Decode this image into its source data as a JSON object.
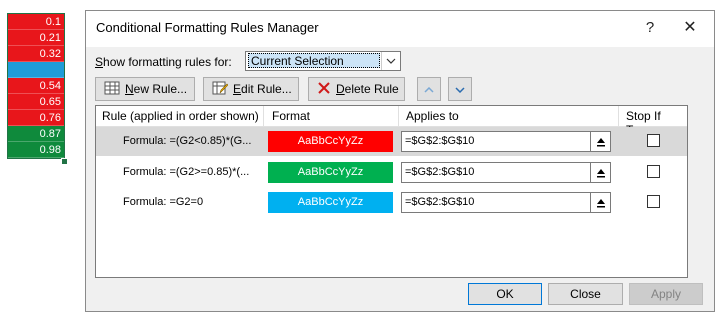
{
  "sheet": {
    "cells": [
      {
        "value": "0.1",
        "color": "#e8161b"
      },
      {
        "value": "0.21",
        "color": "#e8161b"
      },
      {
        "value": "0.32",
        "color": "#e8161b"
      },
      {
        "value": "",
        "color": "#1f9cd9"
      },
      {
        "value": "0.54",
        "color": "#e8161b"
      },
      {
        "value": "0.65",
        "color": "#e8161b"
      },
      {
        "value": "0.76",
        "color": "#e8161b"
      },
      {
        "value": "0.87",
        "color": "#0f8a3c"
      },
      {
        "value": "0.98",
        "color": "#0f8a3c"
      }
    ]
  },
  "dialog": {
    "title": "Conditional Formatting Rules Manager",
    "help_glyph": "?",
    "close_glyph": "✕",
    "show_label_prefix": "S",
    "show_label_rest": "how formatting rules for:",
    "show_value": "Current Selection",
    "toolbar": {
      "new_rule_u": "N",
      "new_rule_rest": "ew Rule...",
      "edit_rule_u": "E",
      "edit_rule_rest": "dit Rule...",
      "delete_rule_u": "D",
      "delete_rule_rest": "elete Rule"
    },
    "columns": {
      "rule": "Rule (applied in order shown)",
      "format": "Format",
      "applies": "Applies to",
      "stop": "Stop If True"
    },
    "rules": [
      {
        "rule": "Formula: =(G2<0.85)*(G...",
        "format_text": "AaBbCcYyZz",
        "format_color": "#ff0000",
        "applies_to": "=$G$2:$G$10",
        "selected": true
      },
      {
        "rule": "Formula: =(G2>=0.85)*(...",
        "format_text": "AaBbCcYyZz",
        "format_color": "#00b050",
        "applies_to": "=$G$2:$G$10",
        "selected": false
      },
      {
        "rule": "Formula: =G2=0",
        "format_text": "AaBbCcYyZz",
        "format_color": "#00b0f0",
        "applies_to": "=$G$2:$G$10",
        "selected": false
      }
    ],
    "buttons": {
      "ok": "OK",
      "close": "Close",
      "apply": "Apply"
    }
  }
}
